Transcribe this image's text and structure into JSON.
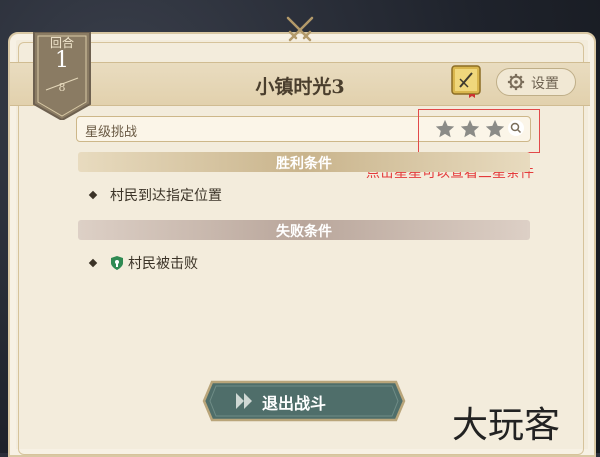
{
  "round": {
    "label": "回合",
    "current": "1",
    "max": "8"
  },
  "level_title": "小镇时光3",
  "settings_label": "设置",
  "star_challenge": {
    "label": "星级挑战",
    "stars": 3
  },
  "annotation": "点击星星可以查看三星条件",
  "win": {
    "header": "胜利条件",
    "items": [
      "村民到达指定位置"
    ]
  },
  "fail": {
    "header": "失败条件",
    "items": [
      "村民被击败"
    ]
  },
  "exit_label": "退出战斗",
  "watermark": "大玩客",
  "colors": {
    "annotation_red": "#e43b3b",
    "exit_button": "#4f6e6a",
    "badge": "#8a7b63"
  }
}
